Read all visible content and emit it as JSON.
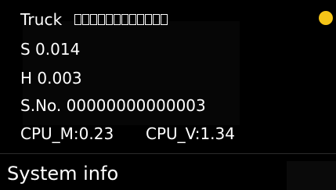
{
  "info": {
    "model_label": "Truck",
    "model_value_boxes": 12,
    "s_value": "S 0.014",
    "h_value": "H 0.003",
    "serial": "S.No. 00000000000003",
    "cpu_m": "CPU_M:0.23",
    "cpu_v": "CPU_V:1.34"
  },
  "footer": {
    "title": "System info",
    "status_color": "#f5c518"
  },
  "colors": {
    "background": "#000000",
    "text": "#ffffff",
    "status_indicator": "#f5c518"
  }
}
